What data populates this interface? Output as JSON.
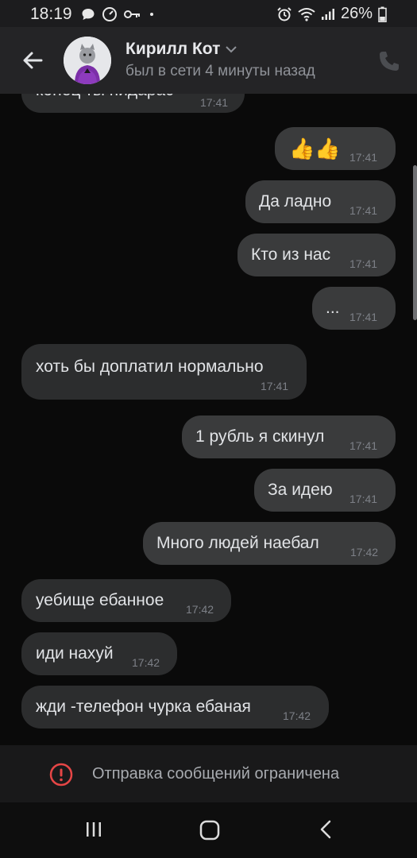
{
  "status_bar": {
    "time": "18:19",
    "battery": "26%"
  },
  "header": {
    "name": "Кирилл Кот",
    "status": "был в сети 4 минуты назад"
  },
  "messages": [
    {
      "dir": "in",
      "text": "конец ты пидарас",
      "time": "17:41"
    },
    {
      "dir": "out",
      "text": "👍👍",
      "time": "17:41"
    },
    {
      "dir": "out",
      "text": "Да ладно",
      "time": "17:41"
    },
    {
      "dir": "out",
      "text": "Кто из нас",
      "time": "17:41"
    },
    {
      "dir": "out",
      "text": "...",
      "time": "17:41"
    },
    {
      "dir": "in",
      "text": "хоть бы доплатил нормально",
      "time": "17:41"
    },
    {
      "dir": "out",
      "text": "1 рубль я скинул",
      "time": "17:41"
    },
    {
      "dir": "out",
      "text": "За идею",
      "time": "17:41"
    },
    {
      "dir": "out",
      "text": "Много людей наебал",
      "time": "17:42"
    },
    {
      "dir": "in",
      "text": "уебище ебанное",
      "time": "17:42"
    },
    {
      "dir": "in",
      "text": "иди нахуй",
      "time": "17:42"
    },
    {
      "dir": "in",
      "text": "жди -телефон чурка ебаная",
      "time": "17:42"
    }
  ],
  "footer": {
    "restriction": "Отправка сообщений ограничена"
  },
  "colors": {
    "background": "#0a0a0a",
    "bubble_in": "#2c2d2e",
    "bubble_out": "#3a3b3c",
    "warning": "#e64646"
  }
}
